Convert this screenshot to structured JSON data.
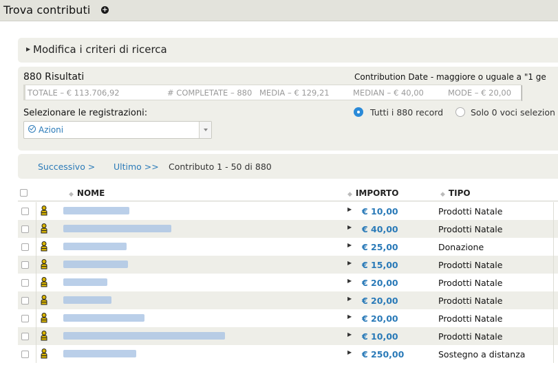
{
  "header": {
    "title": "Trova contributi",
    "add_icon": "plus-circle-icon"
  },
  "criteria": {
    "toggle_label": "Modifica i criteri di ricerca"
  },
  "results": {
    "count_label": "880 Risultati",
    "filter_label": "Contribution Date - maggiore o uguale a \"1 ge",
    "stats": {
      "total": "TOTALE – € 113.706,92",
      "completed": "# COMPLETATE – 880",
      "mean": "MEDIA – € 129,21",
      "median": "MEDIAN – € 40,00",
      "mode": "MODE – € 20,00"
    },
    "select_label": "Selezionare le registrazioni:",
    "actions_value": "Azioni",
    "radio_all": "Tutti i 880 record",
    "radio_selected": "Solo 0 voci selezion"
  },
  "pager": {
    "next_label": "Successivo >",
    "last_label": "Ultimo >>",
    "info": "Contributo 1 - 50 di 880"
  },
  "table": {
    "columns": {
      "name": "NOME",
      "amount": "IMPORTO",
      "type": "TIPO"
    },
    "rows": [
      {
        "amount": "€ 10,00",
        "type": "Prodotti Natale"
      },
      {
        "amount": "€ 40,00",
        "type": "Prodotti Natale"
      },
      {
        "amount": "€ 25,00",
        "type": "Donazione"
      },
      {
        "amount": "€ 15,00",
        "type": "Prodotti Natale"
      },
      {
        "amount": "€ 20,00",
        "type": "Prodotti Natale"
      },
      {
        "amount": "€ 20,00",
        "type": "Prodotti Natale"
      },
      {
        "amount": "€ 20,00",
        "type": "Prodotti Natale"
      },
      {
        "amount": "€ 10,00",
        "type": "Prodotti Natale"
      },
      {
        "amount": "€ 250,00",
        "type": "Sostegno a distanza"
      }
    ]
  },
  "colors": {
    "accent": "#2a7ab8",
    "panel": "#efefe9",
    "alt_row": "#eeeee8"
  }
}
